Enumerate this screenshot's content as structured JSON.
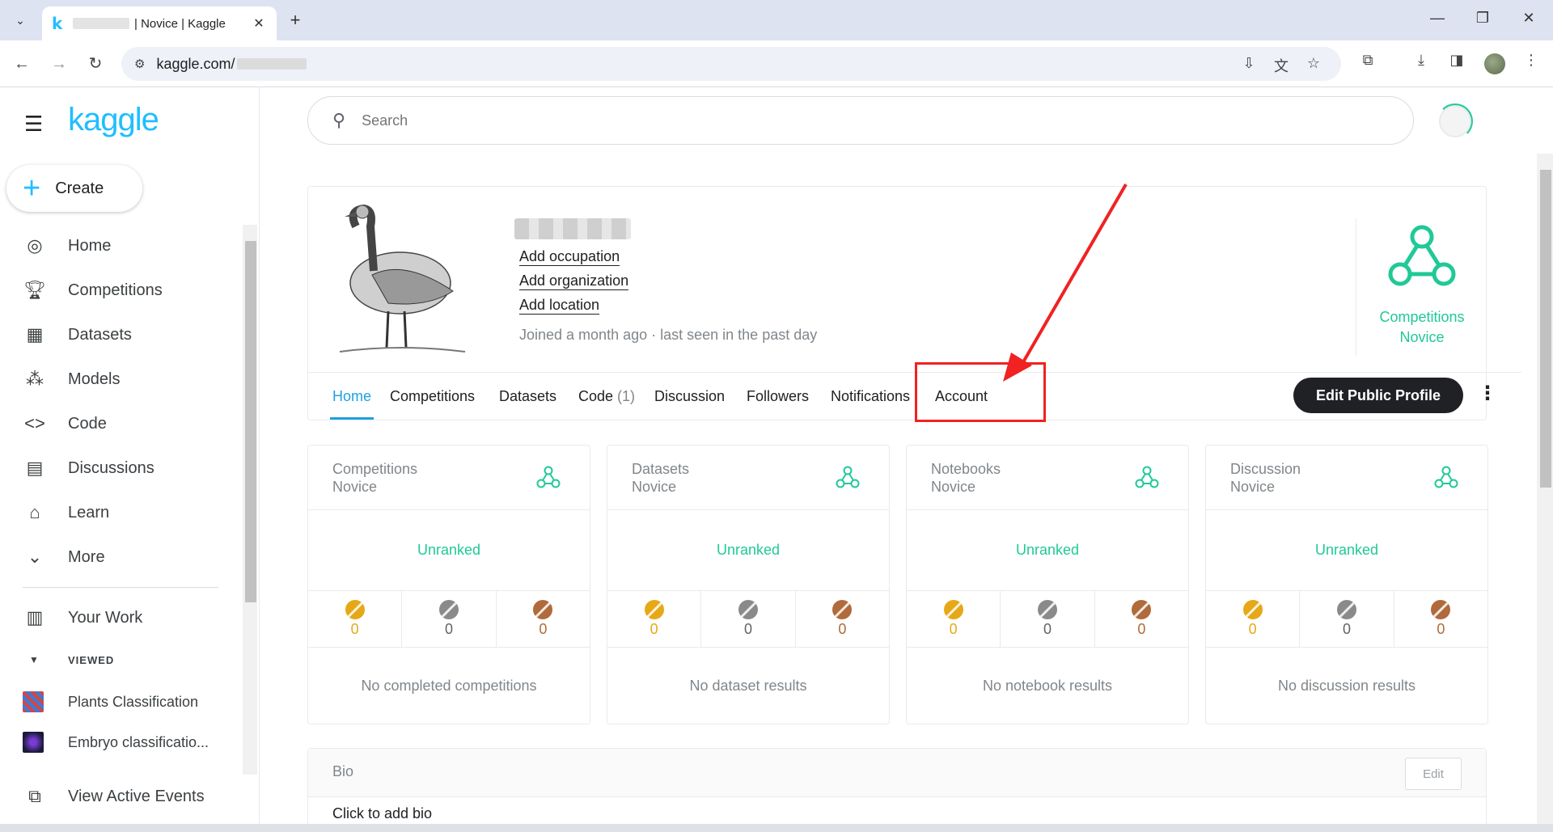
{
  "browser": {
    "tab_title": "| Novice | Kaggle",
    "url": "kaggle.com/",
    "favicon_letter": "k",
    "new_tab": "+",
    "tab_close": "✕"
  },
  "sidebar": {
    "logo": "kaggle",
    "create_label": "Create",
    "items": [
      {
        "label": "Home",
        "icon": "compass-icon"
      },
      {
        "label": "Competitions",
        "icon": "trophy-icon"
      },
      {
        "label": "Datasets",
        "icon": "table-icon"
      },
      {
        "label": "Models",
        "icon": "models-icon"
      },
      {
        "label": "Code",
        "icon": "code-icon"
      },
      {
        "label": "Discussions",
        "icon": "discussion-icon"
      },
      {
        "label": "Learn",
        "icon": "graduation-cap-icon"
      },
      {
        "label": "More",
        "icon": "chevron-down-icon"
      }
    ],
    "your_work": "Your Work",
    "viewed_label": "VIEWED",
    "recent": [
      {
        "label": "Plants Classification"
      },
      {
        "label": "Embryo classificatio..."
      }
    ],
    "view_active_events": "View Active Events"
  },
  "search": {
    "placeholder": "Search"
  },
  "profile": {
    "add_occupation": "Add occupation",
    "add_organization": "Add organization",
    "add_location": "Add location",
    "joined": "Joined a month ago · last seen in the past day",
    "tier_line1": "Competitions",
    "tier_line2": "Novice",
    "tier_color": "#20c997"
  },
  "profile_tabs": {
    "home": "Home",
    "competitions": "Competitions",
    "datasets": "Datasets",
    "code": "Code",
    "code_count": "(1)",
    "discussion": "Discussion",
    "followers": "Followers",
    "notifications": "Notifications",
    "account": "Account",
    "edit_profile": "Edit Public Profile"
  },
  "stats": [
    {
      "title1": "Competitions",
      "title2": "Novice",
      "rank": "Unranked",
      "gold": "0",
      "silver": "0",
      "bronze": "0",
      "empty": "No completed competitions"
    },
    {
      "title1": "Datasets",
      "title2": "Novice",
      "rank": "Unranked",
      "gold": "0",
      "silver": "0",
      "bronze": "0",
      "empty": "No dataset results"
    },
    {
      "title1": "Notebooks",
      "title2": "Novice",
      "rank": "Unranked",
      "gold": "0",
      "silver": "0",
      "bronze": "0",
      "empty": "No notebook results"
    },
    {
      "title1": "Discussion",
      "title2": "Novice",
      "rank": "Unranked",
      "gold": "0",
      "silver": "0",
      "bronze": "0",
      "empty": "No discussion results"
    }
  ],
  "medal_colors": {
    "gold": "#e6a817",
    "silver": "#8a8a8a",
    "bronze": "#b06a3b"
  },
  "bio": {
    "title": "Bio",
    "edit": "Edit",
    "placeholder": "Click to add bio"
  }
}
